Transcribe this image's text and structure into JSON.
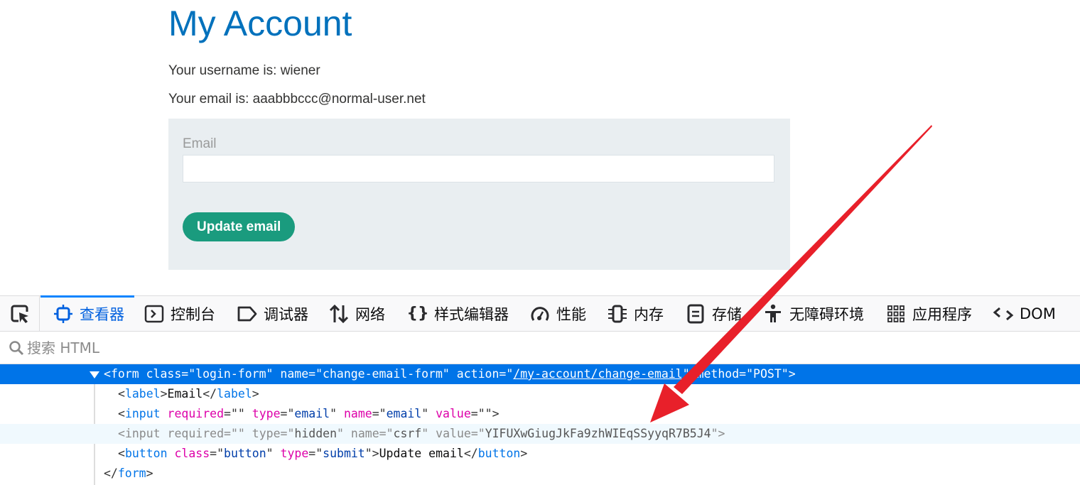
{
  "page": {
    "title": "My Account",
    "username_line": "Your username is: wiener",
    "email_line": "Your email is: aaabbbccc@normal-user.net",
    "form": {
      "email_label": "Email",
      "email_value": "",
      "email_placeholder": "",
      "submit_label": "Update email"
    },
    "colors": {
      "title": "#0071bc",
      "button": "#1a9b7e",
      "form_bg": "#e9eef1"
    }
  },
  "devtools": {
    "tabs": [
      {
        "label": "查看器",
        "icon": "inspector-icon",
        "active": true
      },
      {
        "label": "控制台",
        "icon": "console-icon"
      },
      {
        "label": "调试器",
        "icon": "debugger-icon"
      },
      {
        "label": "网络",
        "icon": "network-icon"
      },
      {
        "label": "样式编辑器",
        "icon": "style-editor-icon"
      },
      {
        "label": "性能",
        "icon": "performance-icon"
      },
      {
        "label": "内存",
        "icon": "memory-icon"
      },
      {
        "label": "存储",
        "icon": "storage-icon"
      },
      {
        "label": "无障碍环境",
        "icon": "accessibility-icon"
      },
      {
        "label": "应用程序",
        "icon": "application-icon"
      },
      {
        "label": "DOM",
        "icon": "dom-icon"
      }
    ],
    "search_placeholder": "搜索 HTML",
    "markup": {
      "form_open": {
        "tag": "form",
        "attrs": [
          {
            "name": "class",
            "value": "login-form"
          },
          {
            "name": "name",
            "value": "change-email-form"
          },
          {
            "name": "action",
            "value": "/my-account/change-email"
          },
          {
            "name": "method",
            "value": "POST"
          }
        ]
      },
      "label_line": {
        "tag": "label",
        "text": "Email"
      },
      "email_input": {
        "tag": "input",
        "attrs": [
          {
            "name": "required",
            "value": ""
          },
          {
            "name": "type",
            "value": "email"
          },
          {
            "name": "name",
            "value": "email"
          },
          {
            "name": "value",
            "value": ""
          }
        ]
      },
      "csrf_input": {
        "tag": "input",
        "attrs": [
          {
            "name": "required",
            "value": ""
          },
          {
            "name": "type",
            "value": "hidden"
          },
          {
            "name": "name",
            "value": "csrf"
          },
          {
            "name": "value",
            "value": "YIFUXwGiugJkFa9zhWIEqSSyyqR7B5J4"
          }
        ]
      },
      "button_line": {
        "tag": "button",
        "attrs": [
          {
            "name": "class",
            "value": "button"
          },
          {
            "name": "type",
            "value": "submit"
          }
        ],
        "text": "Update email"
      },
      "form_close": {
        "tag": "form"
      }
    }
  },
  "annotation": {
    "type": "arrow",
    "color": "#e8202a",
    "points_to": "csrf-token-value"
  }
}
